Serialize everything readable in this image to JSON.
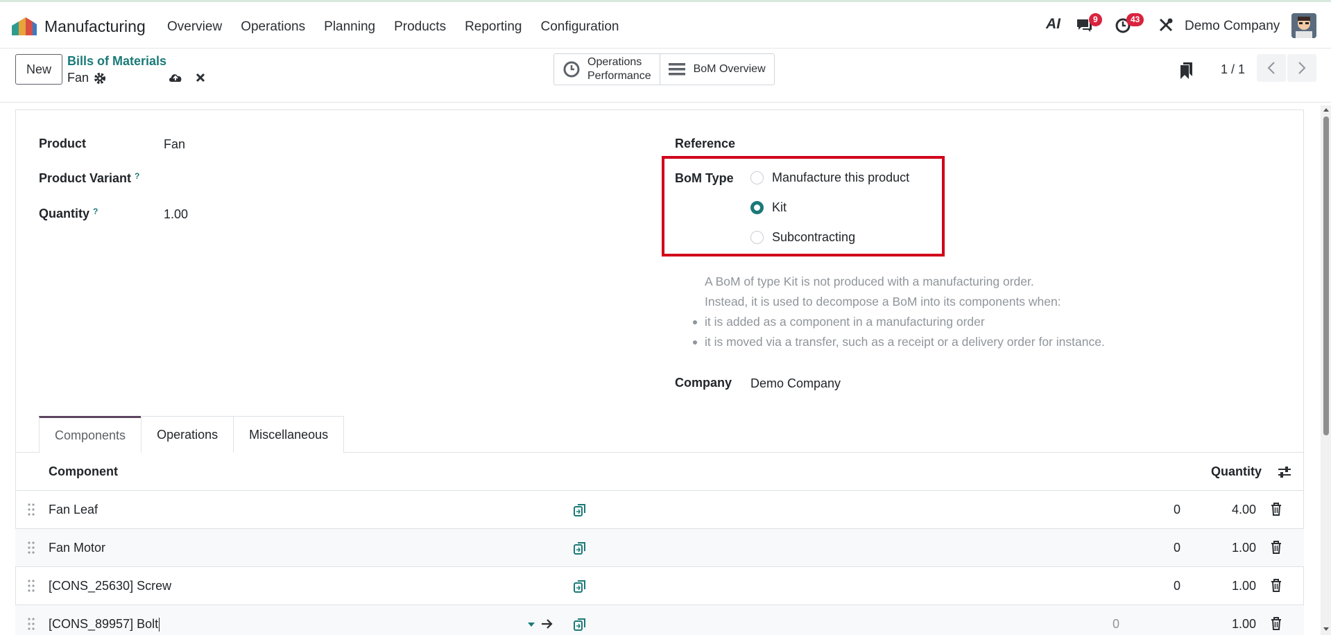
{
  "navbar": {
    "app_name": "Manufacturing",
    "menu": [
      "Overview",
      "Operations",
      "Planning",
      "Products",
      "Reporting",
      "Configuration"
    ],
    "ai_label": "AI",
    "messages_badge": "9",
    "activities_badge": "43",
    "company": "Demo Company"
  },
  "control": {
    "new_label": "New",
    "breadcrumb": "Bills of Materials",
    "record_name": "Fan",
    "stat_operations_line1": "Operations",
    "stat_operations_line2": "Performance",
    "stat_overview": "BoM Overview",
    "pager": "1 / 1"
  },
  "form": {
    "product_label": "Product",
    "product_value": "Fan",
    "variant_label": "Product Variant",
    "quantity_label": "Quantity",
    "quantity_value": "1.00",
    "help_mark": "?",
    "reference_label": "Reference",
    "bom_type_label": "BoM Type",
    "bom_types": [
      "Manufacture this product",
      "Kit",
      "Subcontracting"
    ],
    "bom_type_selected": "Kit",
    "help_line1": "A BoM of type Kit is not produced with a manufacturing order.",
    "help_line2": "Instead, it is used to decompose a BoM into its components when:",
    "help_bullet1": "it is added as a component in a manufacturing order",
    "help_bullet2": "it is moved via a transfer, such as a receipt or a delivery order for instance.",
    "company_label": "Company",
    "company_value": "Demo Company"
  },
  "tabs": [
    "Components",
    "Operations",
    "Miscellaneous"
  ],
  "table": {
    "col_component": "Component",
    "col_quantity": "Quantity",
    "rows": [
      {
        "component": "Fan Leaf",
        "mid": "0",
        "quantity": "4.00"
      },
      {
        "component": "Fan Motor",
        "mid": "0",
        "quantity": "1.00"
      },
      {
        "component": "[CONS_25630] Screw",
        "mid": "0",
        "quantity": "1.00"
      },
      {
        "component": "[CONS_89957] Bolt",
        "mid": "0",
        "quantity": "1.00"
      }
    ]
  },
  "colors": {
    "accent": "#1a7a78",
    "highlight_border": "#d0021b",
    "badge": "#d9233e"
  }
}
